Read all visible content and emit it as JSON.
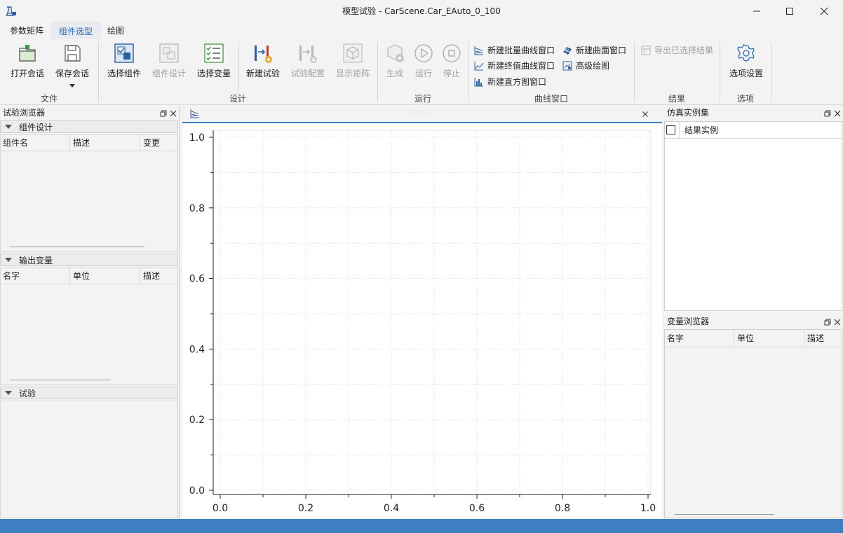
{
  "window": {
    "title": "模型试验 - CarScene.Car_EAuto_0_100"
  },
  "menu": {
    "tabs": [
      {
        "label": "参数矩阵"
      },
      {
        "label": "组件选型"
      },
      {
        "label": "绘图"
      }
    ],
    "active": "组件选型"
  },
  "ribbon": {
    "groups": {
      "file": "文件",
      "design": "设计",
      "run": "运行",
      "curve": "曲线窗口",
      "result": "结果",
      "options": "选项"
    },
    "buttons": {
      "open_session": "打开会话",
      "save_session": "保存会话",
      "select_component": "选择组件",
      "component_design": "组件设计",
      "select_variable": "选择变量",
      "new_experiment": "新建试验",
      "experiment_config": "试验配置",
      "show_matrix": "显示矩阵",
      "generate": "生成",
      "run": "运行",
      "stop": "停止",
      "new_batch_curve": "新建批量曲线窗口",
      "new_surface": "新建曲面窗口",
      "new_final_curve": "新建终值曲线窗口",
      "advanced_plot": "高级绘图",
      "new_histogram": "新建直方图窗口",
      "export_selected": "导出已选择结果",
      "option_settings": "选项设置"
    }
  },
  "left_panel": {
    "title": "试验浏览器",
    "component_design": {
      "title": "组件设计",
      "columns": [
        "组件名",
        "描述",
        "变更"
      ]
    },
    "output_vars": {
      "title": "输出变量",
      "columns": [
        "名字",
        "单位",
        "描述"
      ]
    },
    "experiment": {
      "title": "试验"
    }
  },
  "plot": {
    "tab_label": "Plot-1",
    "chart_data": {
      "type": "line",
      "series": [],
      "xlim": [
        0.0,
        1.0
      ],
      "ylim": [
        0.0,
        1.0
      ],
      "xticks": [
        "0.0",
        "0.2",
        "0.4",
        "0.6",
        "0.8",
        "1.0"
      ],
      "yticks": [
        "0.0",
        "0.2",
        "0.4",
        "0.6",
        "0.8",
        "1.0"
      ],
      "grid": true
    }
  },
  "right_top_panel": {
    "title": "仿真实例集",
    "column": "结果实例"
  },
  "right_bottom_panel": {
    "title": "变量浏览器",
    "columns": [
      "名字",
      "单位",
      "描述"
    ]
  },
  "colors": {
    "accent": "#2b6cb8",
    "statusbar": "#3d7fc1",
    "plot_top_border": "#3d7fc1"
  }
}
